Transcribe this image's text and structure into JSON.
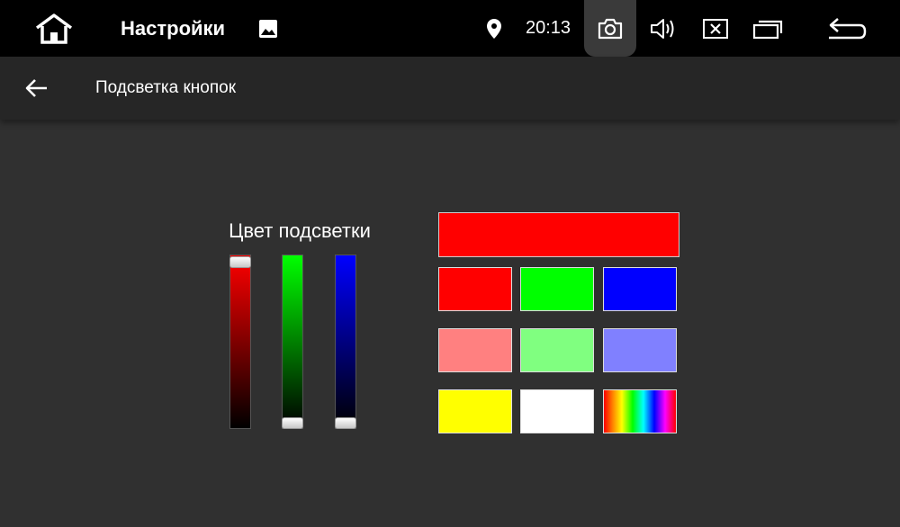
{
  "status_bar": {
    "app_title": "Настройки",
    "time": "20:13",
    "icons": [
      "home-icon",
      "image-icon",
      "location-pin-icon",
      "camera-icon",
      "volume-icon",
      "close-box-icon",
      "recent-apps-icon",
      "return-icon"
    ]
  },
  "app_bar": {
    "title": "Подсветка кнопок",
    "back_icon": "arrow-left-icon"
  },
  "color_section": {
    "label": "Цвет подсветки",
    "current_color": "#ff0000",
    "sliders": [
      {
        "channel": "red",
        "value": 255,
        "max": 255,
        "color": "#ff0000"
      },
      {
        "channel": "green",
        "value": 0,
        "max": 255,
        "color": "#00ff00"
      },
      {
        "channel": "blue",
        "value": 0,
        "max": 255,
        "color": "#0000ff"
      }
    ],
    "swatches": [
      {
        "name": "red",
        "color": "#ff0000"
      },
      {
        "name": "green",
        "color": "#00ff00"
      },
      {
        "name": "blue",
        "color": "#0000ff"
      },
      {
        "name": "light-red",
        "color": "#ff8080"
      },
      {
        "name": "light-green",
        "color": "#80ff80"
      },
      {
        "name": "light-blue",
        "color": "#8080ff"
      },
      {
        "name": "yellow",
        "color": "#ffff00"
      },
      {
        "name": "white",
        "color": "#ffffff"
      },
      {
        "name": "rainbow",
        "color": "rainbow"
      }
    ]
  }
}
